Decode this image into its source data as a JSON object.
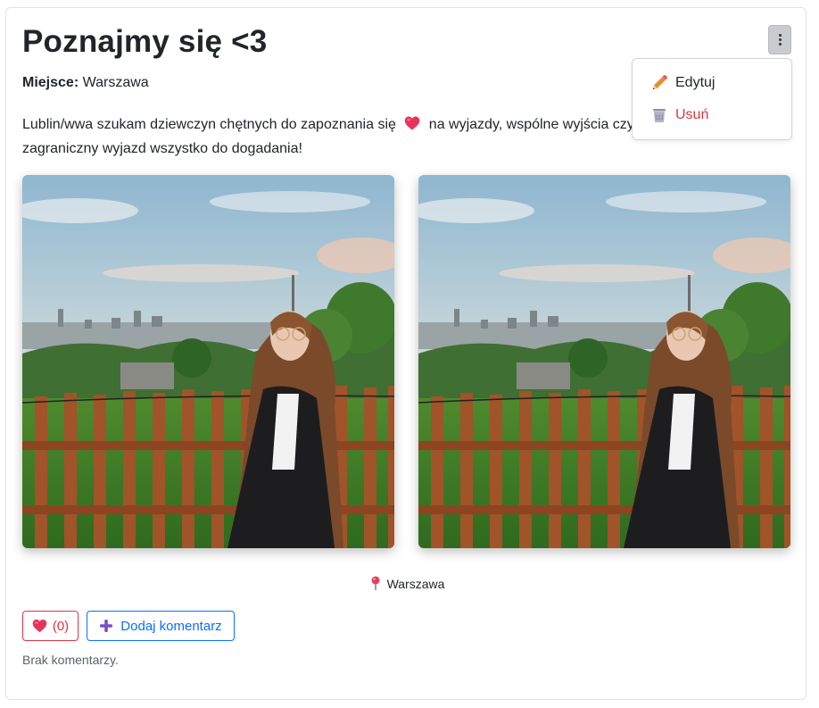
{
  "post": {
    "title": "Poznajmy się <3",
    "place_label": "Miejsce:",
    "place_value": "Warszawa",
    "description_before": "Lublin/wwa szukam dziewczyn chętnych do zapoznania się",
    "description_after": "na wyjazdy, wspólne wyjścia czy zagraniczny wyjazd wszystko do dogadania!",
    "location": "Warszawa"
  },
  "menu": {
    "edit_label": "Edytuj",
    "delete_label": "Usuń"
  },
  "actions": {
    "like_count": "(0)",
    "comment_label": "Dodaj komentarz"
  },
  "comments": {
    "empty_text": "Brak komentarzy."
  },
  "colors": {
    "danger": "#dc3545",
    "primary": "#0d6efd",
    "heart": "#e8335a",
    "plus": "#7b4fc9"
  },
  "icons": {
    "menu": "kebab-icon",
    "edit": "pencil-icon",
    "delete": "trash-icon",
    "location": "pin-icon",
    "like": "heart-icon",
    "add": "plus-icon"
  }
}
